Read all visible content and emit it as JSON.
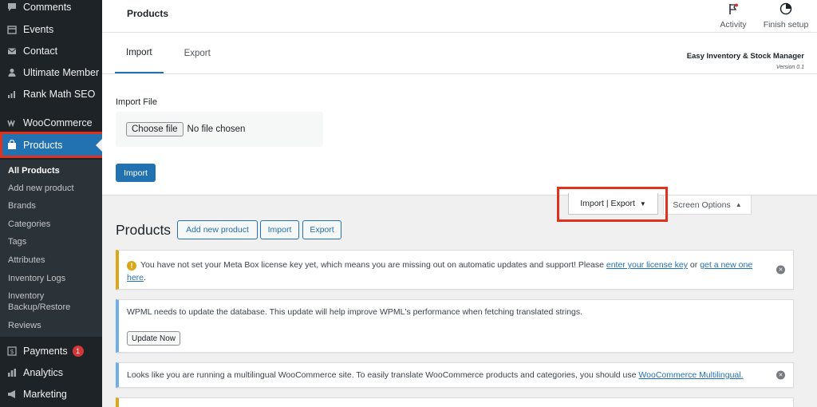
{
  "sidebar": {
    "items": [
      {
        "label": "Comments",
        "icon": "comment-icon"
      },
      {
        "label": "Events",
        "icon": "calendar-icon"
      },
      {
        "label": "Contact",
        "icon": "mail-icon"
      },
      {
        "label": "Ultimate Member",
        "icon": "user-icon"
      },
      {
        "label": "Rank Math SEO",
        "icon": "chart-icon"
      },
      {
        "label": "WooCommerce",
        "icon": "woo-icon"
      },
      {
        "label": "Products",
        "icon": "bag-icon"
      },
      {
        "label": "Payments",
        "icon": "dollar-icon",
        "badge": "1"
      },
      {
        "label": "Analytics",
        "icon": "bar-chart-icon"
      },
      {
        "label": "Marketing",
        "icon": "megaphone-icon"
      }
    ],
    "submenu": [
      "All Products",
      "Add new product",
      "Brands",
      "Categories",
      "Tags",
      "Attributes",
      "Inventory Logs",
      "Inventory Backup/Restore",
      "Reviews"
    ]
  },
  "topbar": {
    "title": "Products",
    "activity": "Activity",
    "finish_setup": "Finish setup"
  },
  "panel": {
    "tabs": [
      "Import",
      "Export"
    ],
    "brand": "Easy Inventory & Stock Manager",
    "version": "Version 0.1",
    "import_file_label": "Import File",
    "choose_file": "Choose file",
    "no_file": "No file chosen",
    "import_button": "Import"
  },
  "screen_meta": {
    "import_export": "Import | Export",
    "screen_options": "Screen Options"
  },
  "main": {
    "heading": "Products",
    "buttons": [
      "Add new product",
      "Import",
      "Export"
    ]
  },
  "notices": {
    "metabox_pre": "You have not set your Meta Box license key yet, which means you are missing out on automatic updates and support! Please ",
    "metabox_link1": "enter your license key",
    "metabox_mid": " or ",
    "metabox_link2": "get a new one here",
    "metabox_end": ".",
    "wpml_text": "WPML needs to update the database. This update will help improve WPML's performance when fetching translated strings.",
    "wpml_button": "Update Now",
    "multilingual_pre": "Looks like you are running a multilingual WooCommerce site. To easily translate WooCommerce products and categories, you should use ",
    "multilingual_link": "WooCommerce Multilingual."
  },
  "colors": {
    "sidebar_bg": "#1d2327",
    "accent": "#2271b1",
    "highlight_box": "#e0301e",
    "warning": "#dba617",
    "info": "#72aee6"
  }
}
